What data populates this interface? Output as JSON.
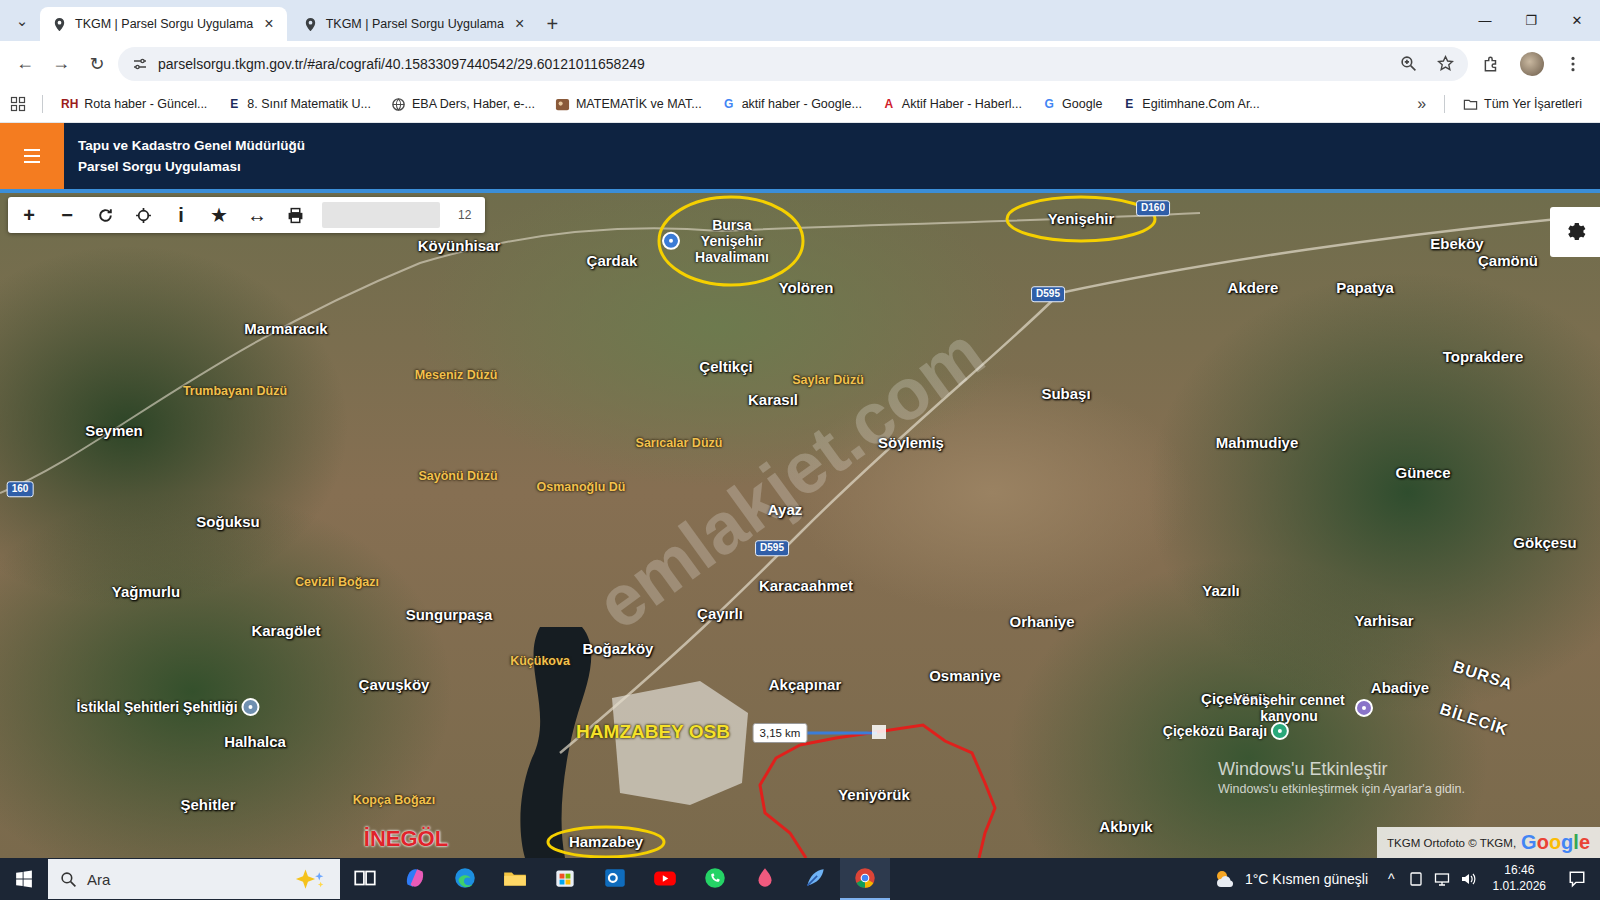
{
  "window": {
    "tab_search": "⌄",
    "new_tab": "+",
    "controls": [
      "—",
      "❐",
      "✕"
    ]
  },
  "tabs": [
    {
      "label": "TKGM | Parsel Sorgu Uygulama",
      "selected": true,
      "close": "×"
    },
    {
      "label": "TKGM | Parsel Sorgu Uygulama",
      "selected": false,
      "close": "×"
    }
  ],
  "toolbar": {
    "nav": [
      "←",
      "→",
      "↻"
    ],
    "url": "parselsorgu.tkgm.gov.tr/#ara/cografi/40.15833097440542/29.60121011658249"
  },
  "bookmarks": {
    "items": [
      {
        "label": "Rota haber - Güncel...",
        "kind": "letter",
        "icon": "RH",
        "color": "#9b1c1c"
      },
      {
        "label": "8. Sınıf Matematik U...",
        "kind": "letter",
        "icon": "E",
        "color": "#1d2b5c"
      },
      {
        "label": "EBA Ders, Haber, e-...",
        "kind": "globe",
        "color": "#4a4a4a"
      },
      {
        "label": "MATEMATİK ve MAT...",
        "kind": "image",
        "color": "#8a5a3a"
      },
      {
        "label": "aktif haber - Google...",
        "kind": "letter",
        "icon": "G",
        "color": "#4285f4"
      },
      {
        "label": "Aktif Haber - Haberl...",
        "kind": "letter",
        "icon": "A",
        "color": "#d0202a"
      },
      {
        "label": "Google",
        "kind": "letter",
        "icon": "G",
        "color": "#4285f4"
      },
      {
        "label": "Egitimhane.Com Ar...",
        "kind": "letter",
        "icon": "E",
        "color": "#1d2b5c"
      }
    ],
    "more": "»",
    "all": "Tüm Yer İşaretleri"
  },
  "app_header": {
    "title": "Tapu ve Kadastro Genel Müdürlüğü",
    "subtitle": "Parsel Sorgu Uygulaması"
  },
  "map_toolbar": {
    "buttons": [
      {
        "kind": "glyph",
        "glyph": "+"
      },
      {
        "kind": "glyph",
        "glyph": "−"
      },
      {
        "kind": "refresh"
      },
      {
        "kind": "locate"
      },
      {
        "kind": "glyph",
        "glyph": "i"
      },
      {
        "kind": "glyph",
        "glyph": "★"
      },
      {
        "kind": "glyph",
        "glyph": "↔"
      },
      {
        "kind": "print"
      }
    ],
    "zoom": "12"
  },
  "map": {
    "labels": [
      {
        "text": "Bursa Yenişehir Havalimanı",
        "kind": "poi",
        "color": "#3a7bd5"
      },
      {
        "text": "Yenişehir",
        "kind": "place"
      },
      {
        "text": "Köyünhisar",
        "kind": "place"
      },
      {
        "text": "Çardak",
        "kind": "place"
      },
      {
        "text": "Yolören",
        "kind": "place"
      },
      {
        "text": "Marmaracık",
        "kind": "place"
      },
      {
        "text": "Çeltikçi",
        "kind": "place"
      },
      {
        "text": "Karasıl",
        "kind": "place"
      },
      {
        "text": "Subaşı",
        "kind": "place"
      },
      {
        "text": "Söylemiş",
        "kind": "place"
      },
      {
        "text": "Seymen",
        "kind": "place"
      },
      {
        "text": "Mahmudiye",
        "kind": "place"
      },
      {
        "text": "Toprakdere",
        "kind": "place"
      },
      {
        "text": "Akdere",
        "kind": "place"
      },
      {
        "text": "Papatya",
        "kind": "place"
      },
      {
        "text": "Ebeköy",
        "kind": "place"
      },
      {
        "text": "Çamönü",
        "kind": "place"
      },
      {
        "text": "Soğuksu",
        "kind": "place"
      },
      {
        "text": "Ayaz",
        "kind": "place"
      },
      {
        "text": "Günece",
        "kind": "place"
      },
      {
        "text": "Gökçesu",
        "kind": "place"
      },
      {
        "text": "Yağmurlu",
        "kind": "place"
      },
      {
        "text": "Karacaahmet",
        "kind": "place"
      },
      {
        "text": "Sungurpaşa",
        "kind": "place"
      },
      {
        "text": "Karagölet",
        "kind": "place"
      },
      {
        "text": "Çayırlı",
        "kind": "place"
      },
      {
        "text": "Orhaniye",
        "kind": "place"
      },
      {
        "text": "Yazılı",
        "kind": "place"
      },
      {
        "text": "Yarhisar",
        "kind": "place"
      },
      {
        "text": "Boğazköy",
        "kind": "place"
      },
      {
        "text": "Akçapınar",
        "kind": "place"
      },
      {
        "text": "Osmaniye",
        "kind": "place"
      },
      {
        "text": "Çavuşköy",
        "kind": "place"
      },
      {
        "text": "Çiçeközü",
        "kind": "place"
      },
      {
        "text": "Abadiye",
        "kind": "place"
      },
      {
        "text": "Halhalca",
        "kind": "place"
      },
      {
        "text": "Yeniyörük",
        "kind": "place"
      },
      {
        "text": "Şehitler",
        "kind": "place"
      },
      {
        "text": "Akbıyık",
        "kind": "place"
      },
      {
        "text": "Hamzabey",
        "kind": "place"
      },
      {
        "text": "İstiklal Şehitleri Şehitliği",
        "kind": "poi",
        "color": "#6f8fb0"
      },
      {
        "text": "Yenişehir cennet kanyonu",
        "kind": "poi",
        "color": "#8a74c9"
      },
      {
        "text": "Çiçeközü Barajı",
        "kind": "poi",
        "color": "#2aa87a"
      },
      {
        "text": "Meseniz Düzü",
        "kind": "area"
      },
      {
        "text": "Saylar Düzü",
        "kind": "area"
      },
      {
        "text": "Trumbayanı Düzü",
        "kind": "area"
      },
      {
        "text": "Sarıcalar Düzü",
        "kind": "area"
      },
      {
        "text": "Sayönü Düzü",
        "kind": "area"
      },
      {
        "text": "Osmanoğlu Dü",
        "kind": "area"
      },
      {
        "text": "Cevizli Boğazı",
        "kind": "area"
      },
      {
        "text": "Küçükova",
        "kind": "area"
      },
      {
        "text": "Kopça Boğazı",
        "kind": "area"
      },
      {
        "text": "D595",
        "kind": "road"
      },
      {
        "text": "D595",
        "kind": "road"
      },
      {
        "text": "D160",
        "kind": "road"
      },
      {
        "text": "160",
        "kind": "road"
      },
      {
        "text": "BURSA",
        "kind": "region"
      },
      {
        "text": "BİLECİK",
        "kind": "region"
      },
      {
        "text": "HAMZABEY OSB",
        "kind": "osb"
      },
      {
        "text": "İNEGÖL",
        "kind": "district"
      }
    ],
    "measure": "3,15 km",
    "watermark": "emlakjet.com",
    "activation": {
      "title": "Windows'u Etkinleştir",
      "text": "Windows'u etkinleştirmek için Ayarlar'a gidin."
    },
    "attribution": {
      "text": "TKGM Ortofoto © TKGM,",
      "brand": "Google"
    }
  },
  "taskbar": {
    "search": "Ara",
    "apps": [
      {
        "kind": "task-view",
        "active": false
      },
      {
        "kind": "copilot",
        "active": false
      },
      {
        "kind": "edge",
        "active": false
      },
      {
        "kind": "explorer",
        "active": false
      },
      {
        "kind": "store",
        "active": false
      },
      {
        "kind": "outlook",
        "active": false
      },
      {
        "kind": "youtube",
        "active": false
      },
      {
        "kind": "whatsapp",
        "active": false
      },
      {
        "kind": "drop",
        "active": false
      },
      {
        "kind": "feather",
        "active": false
      },
      {
        "kind": "chrome",
        "active": true
      }
    ],
    "weather": "1°C Kısmen güneşli",
    "tray": "^",
    "time": "16:46",
    "date": "1.01.2026"
  }
}
